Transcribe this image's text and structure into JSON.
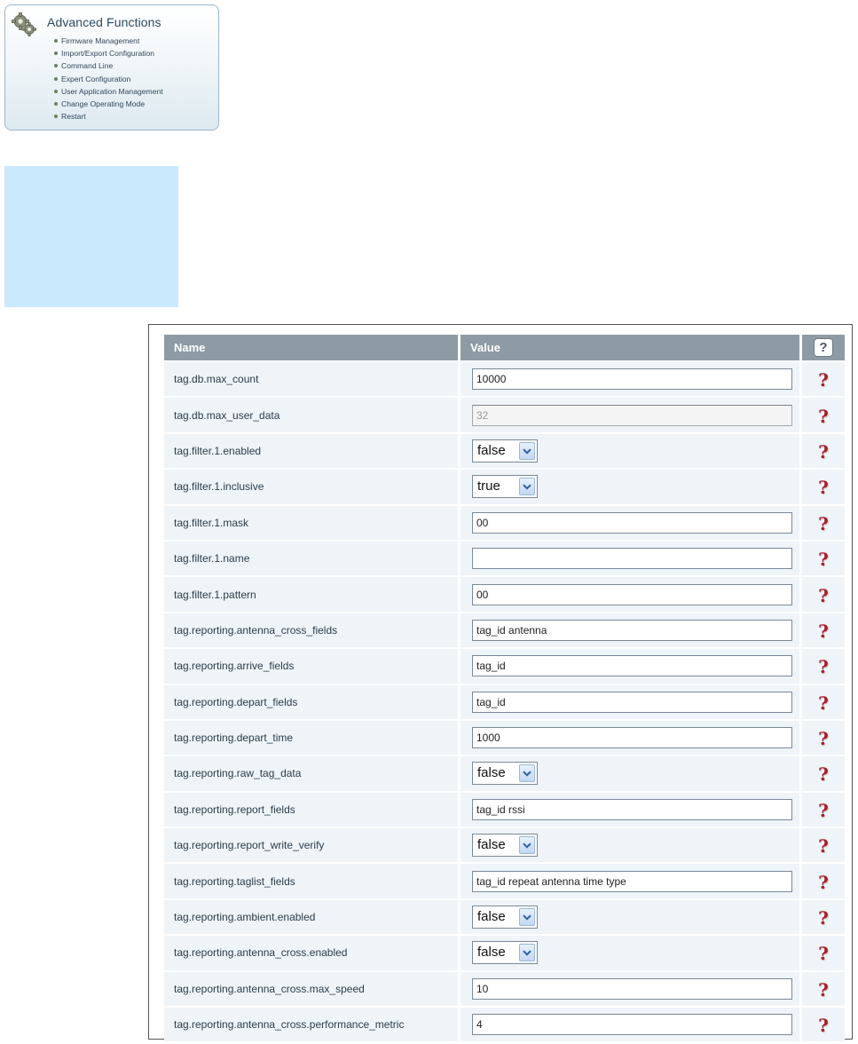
{
  "advanced_functions": {
    "title": "Advanced Functions",
    "icon": "gears-icon",
    "items": [
      {
        "label": "Firmware Management"
      },
      {
        "label": "Import/Export Configuration"
      },
      {
        "label": "Command Line"
      },
      {
        "label": "Expert Configuration"
      },
      {
        "label": "User Application Management"
      },
      {
        "label": "Change Operating Mode"
      },
      {
        "label": "Restart"
      }
    ]
  },
  "colors": {
    "header_bg": "#8e9ba5",
    "row_bg": "#eef4f8",
    "help_icon": "#a61e2a",
    "side_block": "#cbe9fd"
  },
  "table": {
    "header": {
      "name": "Name",
      "value": "Value",
      "help": "?"
    },
    "help_icon": "question-mark-icon",
    "help_symbol": "?",
    "rows": [
      {
        "name": "tag.db.max_count",
        "type": "text",
        "value": "10000"
      },
      {
        "name": "tag.db.max_user_data",
        "type": "text-disabled",
        "value": "32"
      },
      {
        "name": "tag.filter.1.enabled",
        "type": "select",
        "value": "false"
      },
      {
        "name": "tag.filter.1.inclusive",
        "type": "select",
        "value": "true"
      },
      {
        "name": "tag.filter.1.mask",
        "type": "text",
        "value": "00"
      },
      {
        "name": "tag.filter.1.name",
        "type": "text",
        "value": ""
      },
      {
        "name": "tag.filter.1.pattern",
        "type": "text",
        "value": "00"
      },
      {
        "name": "tag.reporting.antenna_cross_fields",
        "type": "text",
        "value": "tag_id antenna"
      },
      {
        "name": "tag.reporting.arrive_fields",
        "type": "text",
        "value": "tag_id"
      },
      {
        "name": "tag.reporting.depart_fields",
        "type": "text",
        "value": "tag_id"
      },
      {
        "name": "tag.reporting.depart_time",
        "type": "text",
        "value": "1000"
      },
      {
        "name": "tag.reporting.raw_tag_data",
        "type": "select",
        "value": "false"
      },
      {
        "name": "tag.reporting.report_fields",
        "type": "text",
        "value": "tag_id rssi"
      },
      {
        "name": "tag.reporting.report_write_verify",
        "type": "select",
        "value": "false"
      },
      {
        "name": "tag.reporting.taglist_fields",
        "type": "text",
        "value": "tag_id repeat antenna time type"
      },
      {
        "name": "tag.reporting.ambient.enabled",
        "type": "select",
        "value": "false"
      },
      {
        "name": "tag.reporting.antenna_cross.enabled",
        "type": "select",
        "value": "false"
      },
      {
        "name": "tag.reporting.antenna_cross.max_speed",
        "type": "text",
        "value": "10"
      },
      {
        "name": "tag.reporting.antenna_cross.performance_metric",
        "type": "text",
        "value": "4"
      }
    ]
  }
}
